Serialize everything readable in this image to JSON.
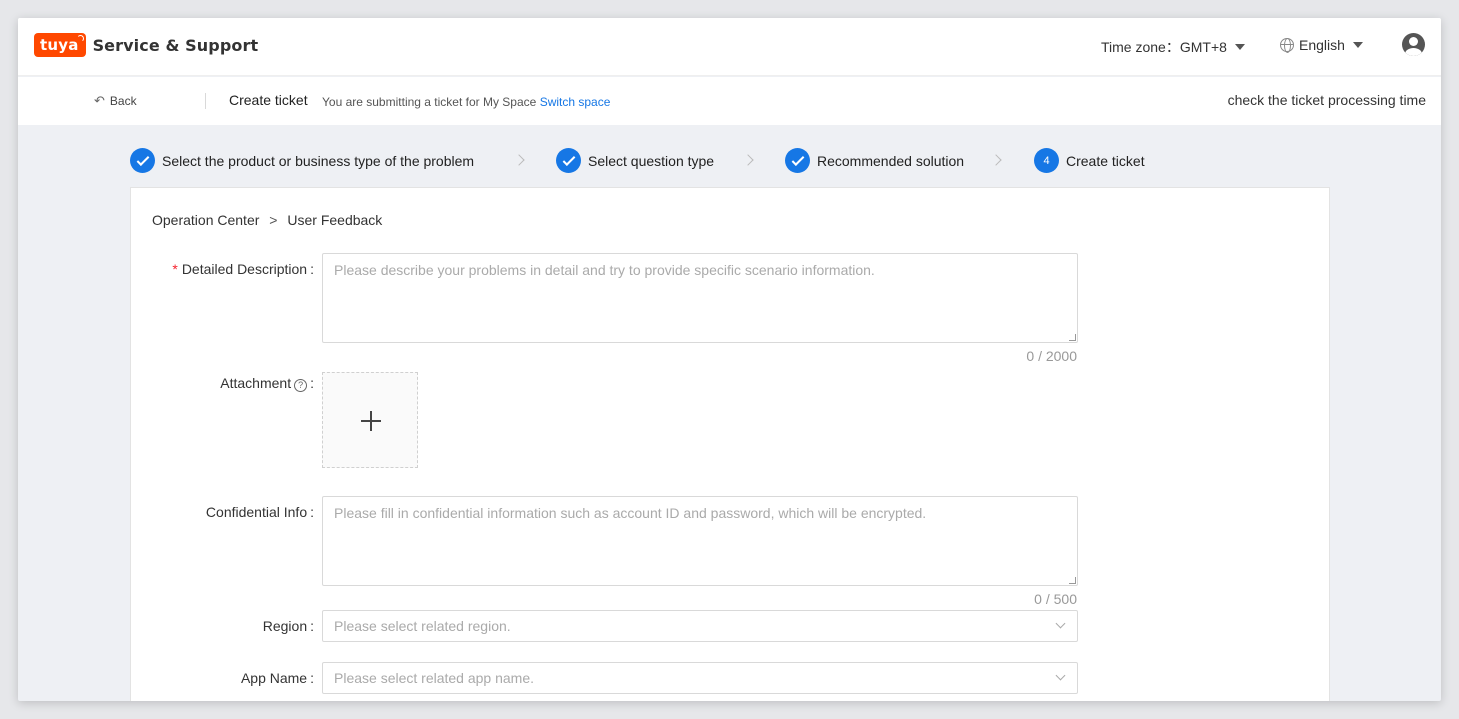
{
  "header": {
    "logo_text": "tuya",
    "product_name": "Service & Support",
    "timezone_label": "Time zone：",
    "timezone_value": "GMT+8",
    "language": "English"
  },
  "subbar": {
    "back_label": "Back",
    "title": "Create ticket",
    "note": "You are submitting a ticket for My Space",
    "switch_link": "Switch space",
    "check_time": "check the ticket processing time"
  },
  "steps": [
    {
      "label": "Select the product or business type of the problem",
      "status": "done"
    },
    {
      "label": "Select question type",
      "status": "done"
    },
    {
      "label": "Recommended solution",
      "status": "done"
    },
    {
      "label": "Create ticket",
      "status": "current",
      "number": "4"
    }
  ],
  "breadcrumb": {
    "parent": "Operation Center",
    "separator": ">",
    "current": "User Feedback"
  },
  "form": {
    "description": {
      "label": "Detailed Description",
      "required_mark": "*",
      "placeholder": "Please describe your problems in detail and try to provide specific scenario information.",
      "value": "",
      "counter": "0 / 2000"
    },
    "attachment": {
      "label": "Attachment",
      "help_glyph": "?"
    },
    "confidential": {
      "label": "Confidential Info",
      "placeholder": "Please fill in confidential information such as account ID and password, which will be encrypted.",
      "value": "",
      "counter": "0 / 500"
    },
    "region": {
      "label": "Region",
      "placeholder": "Please select related region."
    },
    "app_name": {
      "label": "App Name",
      "placeholder": "Please select related app name."
    },
    "colon": ":"
  },
  "colors": {
    "accent": "#1677e5",
    "brand": "#ff4800",
    "required": "#f5222d"
  }
}
